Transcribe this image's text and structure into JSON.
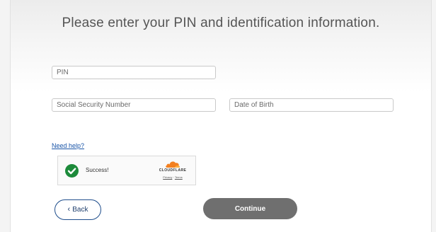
{
  "page": {
    "title": "Please enter your PIN and identification information."
  },
  "form": {
    "pin_placeholder": "PIN",
    "ssn_placeholder": "Social Security Number",
    "dob_placeholder": "Date of Birth"
  },
  "help": {
    "link_text": "Need help?"
  },
  "captcha": {
    "status_text": "Success!",
    "status_icon": "checkmark-icon",
    "provider": "CLOUDFLARE",
    "privacy_link": "Privacy",
    "separator": "·",
    "terms_link": "Terms",
    "colors": {
      "success_green": "#1c8a3a",
      "cloudflare_orange": "#f38020"
    }
  },
  "actions": {
    "back_icon": "chevron-left-icon",
    "back_label": "Back",
    "continue_label": "Continue",
    "colors": {
      "back_border": "#1f4e8c",
      "continue_bg": "#6f6f6f"
    }
  }
}
